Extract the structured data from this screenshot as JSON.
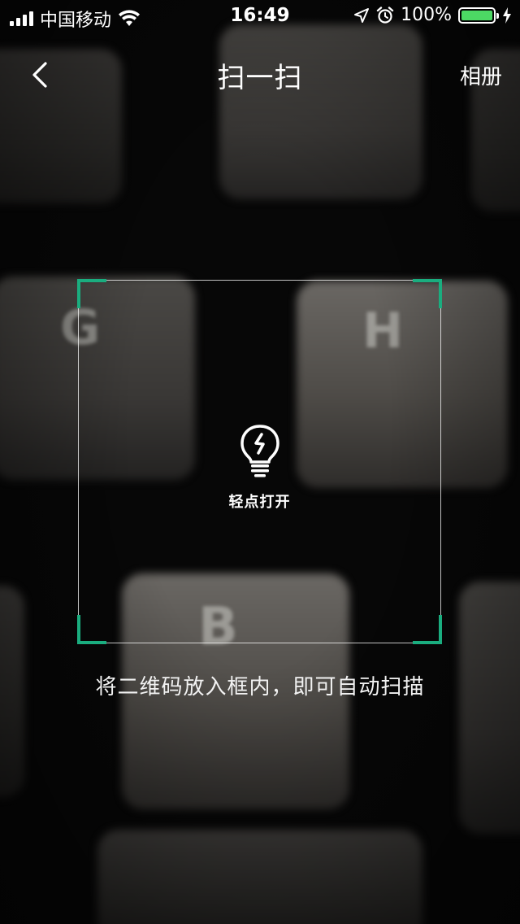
{
  "status_bar": {
    "carrier": "中国移动",
    "time": "16:49",
    "battery_percent_label": "100%",
    "battery_level": 1.0,
    "battery_color": "#4cd964",
    "icons": [
      "signal-icon",
      "wifi-icon",
      "location-icon",
      "alarm-icon",
      "battery-icon",
      "charging-icon"
    ]
  },
  "nav": {
    "back_icon": "chevron-left-icon",
    "title": "扫一扫",
    "album_label": "相册"
  },
  "scanner": {
    "accent_color": "#1aad7f",
    "torch_icon": "lightbulb-icon",
    "torch_label": "轻点打开",
    "hint": "将二维码放入框内，即可自动扫描"
  }
}
